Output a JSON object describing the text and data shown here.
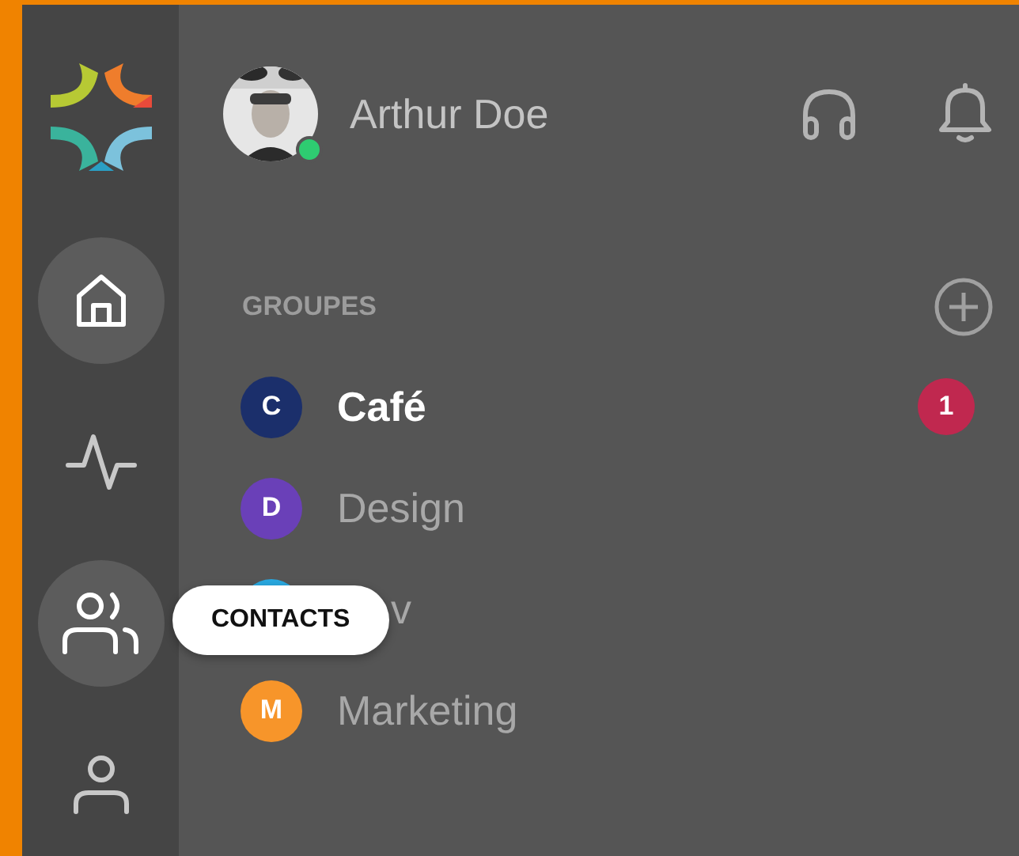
{
  "nav_rail": {
    "items": [
      {
        "kind": "home",
        "highlighted": true
      },
      {
        "kind": "activity",
        "highlighted": false
      },
      {
        "kind": "contacts",
        "highlighted": true,
        "tooltip": "CONTACTS"
      },
      {
        "kind": "profile",
        "highlighted": false
      }
    ]
  },
  "user": {
    "name": "Arthur Doe",
    "online": true
  },
  "section_title": "GROUPES",
  "groups": [
    {
      "letter": "C",
      "name": "Café",
      "color": "#1b2f6b",
      "unread": true,
      "badge": "1"
    },
    {
      "letter": "D",
      "name": "Design",
      "color": "#6a40b8",
      "unread": false
    },
    {
      "name": "v",
      "color": "#29a8e0",
      "unread": false,
      "covered": true
    },
    {
      "letter": "M",
      "name": "Marketing",
      "color": "#f7952a",
      "unread": false
    }
  ]
}
